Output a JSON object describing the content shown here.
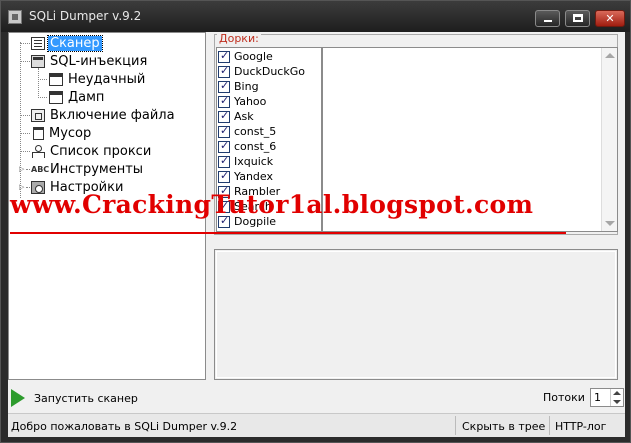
{
  "window": {
    "title": "SQLi Dumper v.9.2"
  },
  "tree": {
    "items": [
      {
        "label": "Сканер",
        "icon": "document-icon",
        "selected": true
      },
      {
        "label": "SQL-инъекция",
        "icon": "database-icon"
      },
      {
        "label": "Неудачный",
        "icon": "window-icon"
      },
      {
        "label": "Дамп",
        "icon": "window-icon"
      },
      {
        "label": "Включение файла",
        "icon": "file-include-icon"
      },
      {
        "label": "Мусор",
        "icon": "trash-icon"
      },
      {
        "label": "Список прокси",
        "icon": "proxy-icon"
      },
      {
        "label": "Инструменты",
        "icon": "tools-icon",
        "badge": "ABC"
      },
      {
        "label": "Настройки",
        "icon": "settings-icon"
      }
    ]
  },
  "dorks": {
    "legend": "Дорки:",
    "engines": [
      "Google",
      "DuckDuckGo",
      "Bing",
      "Yahoo",
      "Ask",
      "const_5",
      "const_6",
      "Ixquick",
      "Yandex",
      "Rambler",
      "Search",
      "Dogpile"
    ],
    "checked": true
  },
  "runbar": {
    "run_label": "Запустить сканер",
    "threads_label": "Потоки",
    "threads_value": "1",
    "play_color": "#2d9b2d"
  },
  "statusbar": {
    "welcome": "Добро пожаловать в SQLi Dumper v.9.2",
    "hide_tray": "Скрыть в трее",
    "http_log": "HTTP-лог"
  },
  "watermark": {
    "text": "www.CrackingTutor1al.blogspot.com",
    "color": "#e10000"
  },
  "colors": {
    "selection": "#3399ff",
    "legend": "#c03020"
  }
}
